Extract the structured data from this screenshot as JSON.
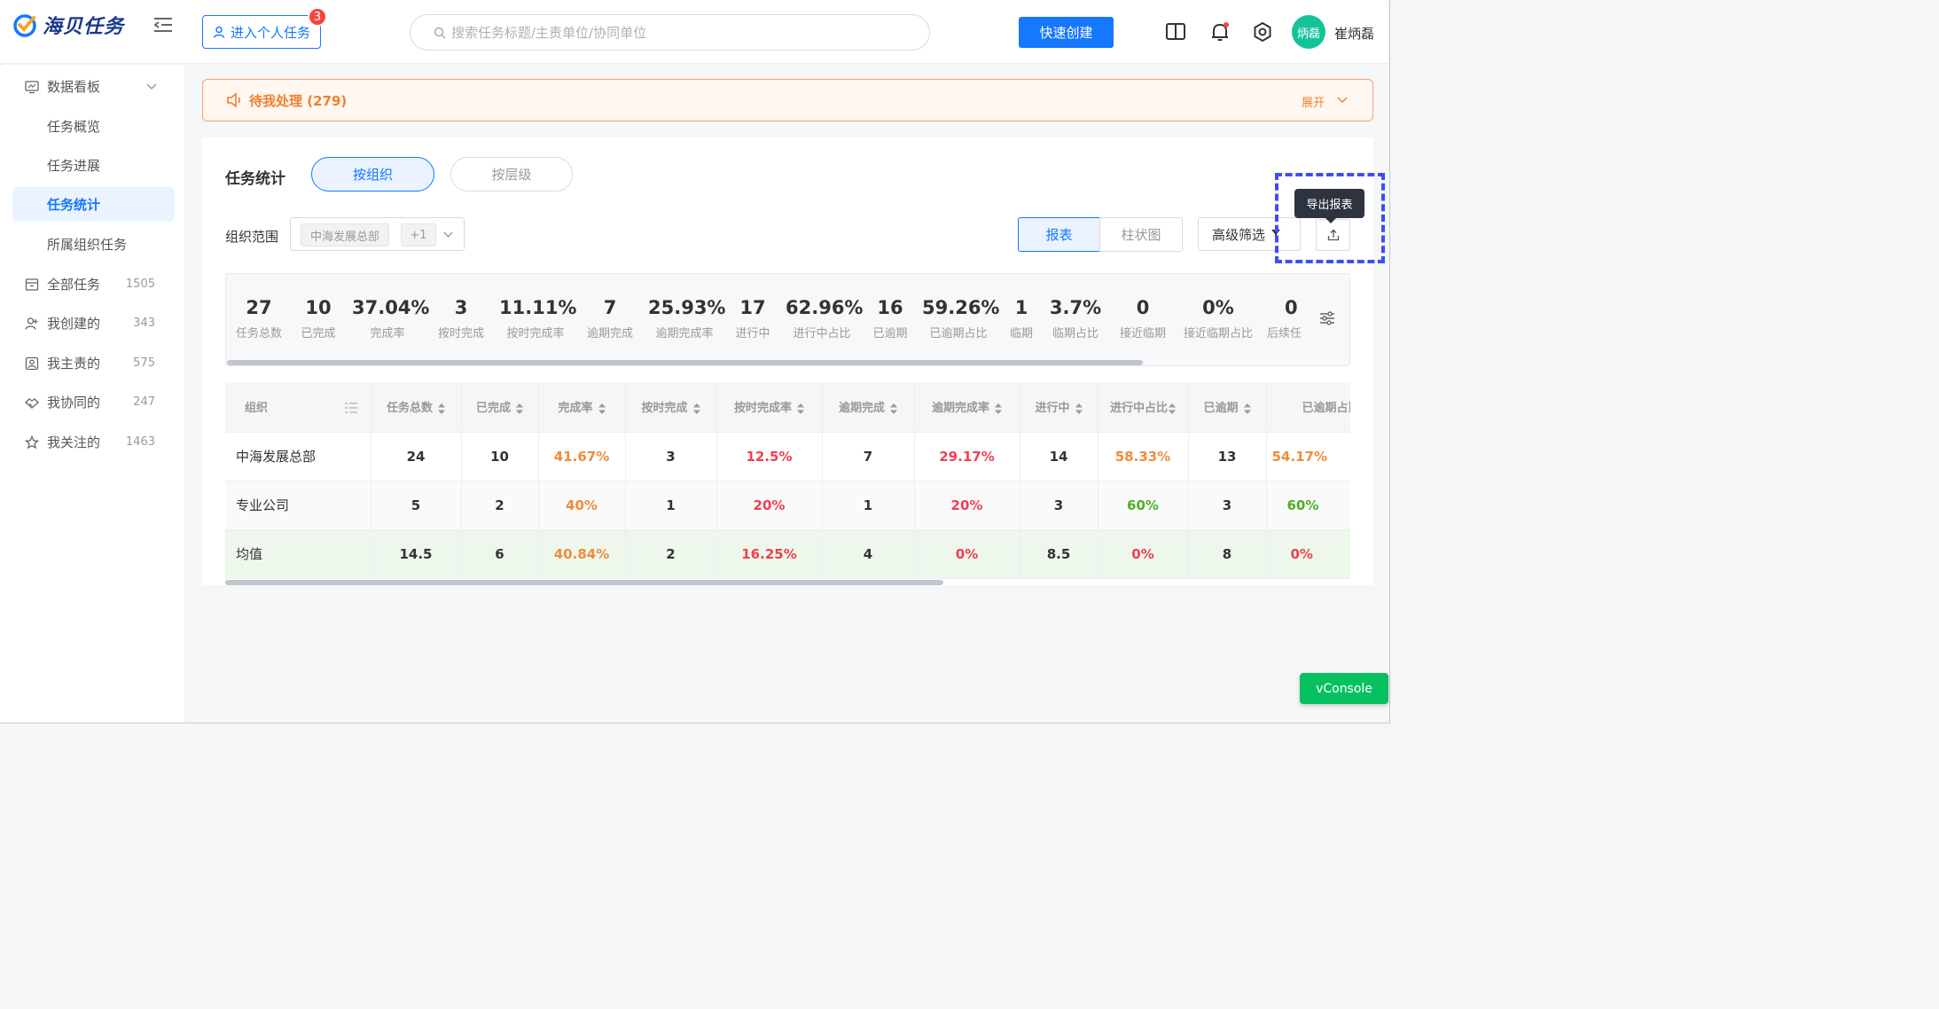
{
  "app": {
    "name": "海贝任务"
  },
  "header": {
    "personal_btn": "进入个人任务",
    "personal_badge": "3",
    "search_placeholder": "搜索任务标题/主责单位/协同单位",
    "quick_create": "快速创建",
    "user": {
      "avatar": "炳磊",
      "name": "崔炳磊"
    }
  },
  "sidebar": {
    "dashboard": "数据看板",
    "sub_items": [
      "任务概览",
      "任务进展",
      "任务统计",
      "所属组织任务"
    ],
    "active": "任务统计",
    "items": [
      {
        "label": "全部任务",
        "count": "1505"
      },
      {
        "label": "我创建的",
        "count": "343"
      },
      {
        "label": "我主责的",
        "count": "575"
      },
      {
        "label": "我协同的",
        "count": "247"
      },
      {
        "label": "我关注的",
        "count": "1463"
      }
    ]
  },
  "pending": {
    "text": "待我处理 (279)",
    "expand": "展开"
  },
  "main": {
    "title": "任务统计",
    "tabs": [
      "按组织",
      "按层级"
    ],
    "org_label": "组织范围",
    "org_tag": "中海发展总部",
    "org_more": "+1",
    "views": [
      "报表",
      "柱状图"
    ],
    "advanced_filter": "高级筛选",
    "export_tooltip": "导出报表"
  },
  "stats": [
    {
      "value": "27",
      "label": "任务总数"
    },
    {
      "value": "10",
      "label": "已完成"
    },
    {
      "value": "37.04%",
      "label": "完成率"
    },
    {
      "value": "3",
      "label": "按时完成"
    },
    {
      "value": "11.11%",
      "label": "按时完成率"
    },
    {
      "value": "7",
      "label": "逾期完成"
    },
    {
      "value": "25.93%",
      "label": "逾期完成率"
    },
    {
      "value": "17",
      "label": "进行中"
    },
    {
      "value": "62.96%",
      "label": "进行中占比"
    },
    {
      "value": "16",
      "label": "已逾期"
    },
    {
      "value": "59.26%",
      "label": "已逾期占比"
    },
    {
      "value": "1",
      "label": "临期"
    },
    {
      "value": "3.7%",
      "label": "临期占比"
    },
    {
      "value": "0",
      "label": "接近临期"
    },
    {
      "value": "0%",
      "label": "接近临期占比"
    },
    {
      "value": "0",
      "label": "后续任"
    }
  ],
  "table": {
    "headers": [
      "组织",
      "任务总数",
      "已完成",
      "完成率",
      "按时完成",
      "按时完成率",
      "逾期完成",
      "逾期完成率",
      "进行中",
      "进行中占比",
      "已逾期",
      "已逾期占比"
    ],
    "rows": [
      [
        "中海发展总部",
        "24",
        "10",
        "41.67%",
        "3",
        "12.5%",
        "7",
        "29.17%",
        "14",
        "58.33%",
        "13",
        "54.17%"
      ],
      [
        "专业公司",
        "5",
        "2",
        "40%",
        "1",
        "20%",
        "1",
        "20%",
        "3",
        "60%",
        "3",
        "60%"
      ],
      [
        "均值",
        "14.5",
        "6",
        "40.84%",
        "2",
        "16.25%",
        "4",
        "0%",
        "8.5",
        "0%",
        "8",
        "0%"
      ]
    ]
  },
  "vconsole": "vConsole",
  "colors": {
    "primary": "#1677ff",
    "orange": "#f08c3a",
    "red": "#f0404f",
    "green": "#4cb020"
  }
}
